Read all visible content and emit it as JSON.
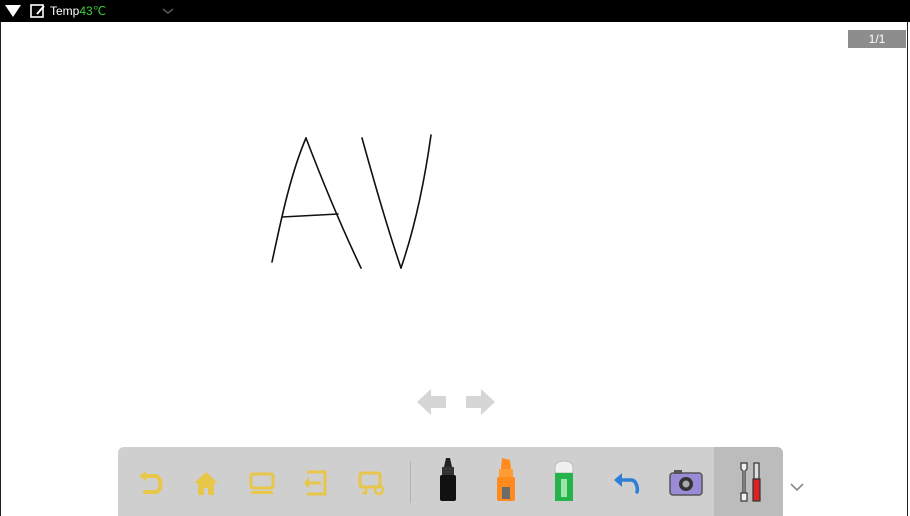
{
  "status_bar": {
    "temp_label": "Temp",
    "temp_value": "43℃",
    "icons": [
      "wifi-icon",
      "whiteboard-app-icon",
      "chevron-down-icon"
    ]
  },
  "page_indicator": "1/1",
  "handwriting": "AV",
  "colors": {
    "statusbar": "#000000",
    "temp_value": "#3ad13a",
    "toolbar": "#cfcfcf",
    "toolbar_icon": "#e3c44a",
    "page_badge": "#8d8d8d",
    "undo_blue": "#2f7fd8"
  },
  "toolbar": {
    "buttons": [
      "back-icon",
      "home-icon",
      "window-icon",
      "exit-icon",
      "screen-settings-icon",
      "marker-pen-icon",
      "highlighter-icon",
      "eraser-icon",
      "undo-icon",
      "camera-icon",
      "tools-icon"
    ]
  },
  "navigation": [
    "previous-page-arrow-icon",
    "next-page-arrow-icon"
  ]
}
